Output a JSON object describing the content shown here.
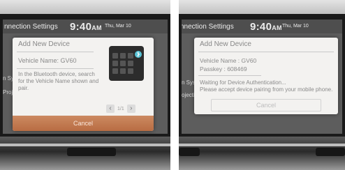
{
  "left_screen": {
    "app_title": "nnection Settings",
    "clock": "9:40",
    "clock_suffix": "AM",
    "date": "Thu, Mar 10",
    "dialog": {
      "title": "Add New Device",
      "vehicle_name": "Vehicle Name: GV60",
      "instructions": "In the Bluetooth device, search for the Vehicle Name shown and pair.",
      "page_indicator": "1/1",
      "cancel_label": "Cancel"
    },
    "background_labels": [
      "n Sys",
      "Projecti"
    ]
  },
  "right_screen": {
    "app_title": "nnection Settings",
    "clock": "9:40",
    "clock_suffix": "AM",
    "date": "Thu, Mar 10",
    "dialog": {
      "title": "Add New Device",
      "vehicle_name": "Vehicle Name : GV60",
      "passkey": "Passkey : 608469",
      "waiting": "Waiting for Device Authentication...",
      "accept_prompt": "Please accept device pairing from your mobile phone.",
      "cancel_label": "Cancel"
    },
    "background_labels": [
      "n Syst",
      "ojecti"
    ]
  },
  "icons": [
    "chevron-left-icon",
    "chevron-right-icon",
    "phone-illustration",
    "bluetooth-icon"
  ],
  "colors": {
    "cancel_active": "#b86c43",
    "dialog_bg": "#f3f2f0",
    "screen_bg": "#5d5d5d"
  }
}
